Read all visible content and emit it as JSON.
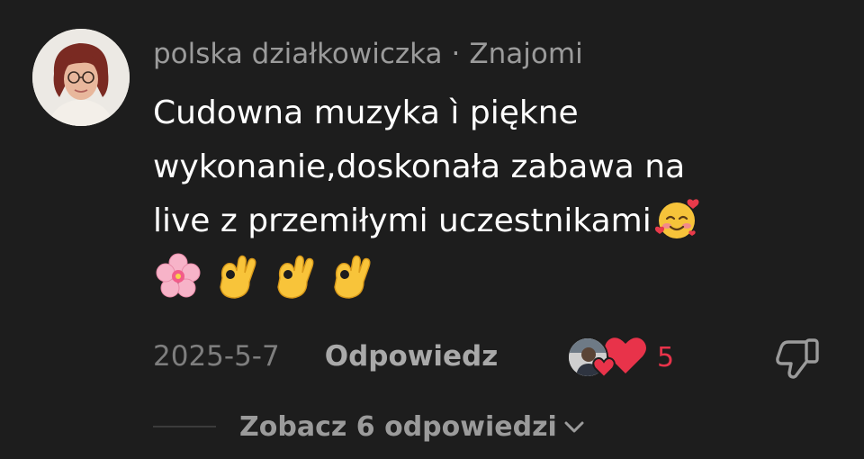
{
  "comment": {
    "author": "polska działkowiczka",
    "separator": "·",
    "relation": "Znajomi",
    "text_lines": [
      "Cudowna muzyka ì piękne",
      "wykonanie,doskonała zabawa na",
      "live z przemiłymi uczestnikami"
    ],
    "emojis": [
      "smiling-face-with-hearts",
      "cherry-blossom",
      "ok-hand",
      "ok-hand",
      "ok-hand"
    ],
    "date": "2025-5-7",
    "reply_label": "Odpowiedz",
    "like_count": "5",
    "view_replies_label": "Zobacz 6 odpowiedzi"
  },
  "colors": {
    "background": "#1d1d1d",
    "muted_text": "#9b9b9b",
    "like_red": "#e8334a"
  },
  "icons": {
    "heart": "heart-icon",
    "dislike": "thumbs-down-icon",
    "expand": "chevron-down-icon"
  }
}
